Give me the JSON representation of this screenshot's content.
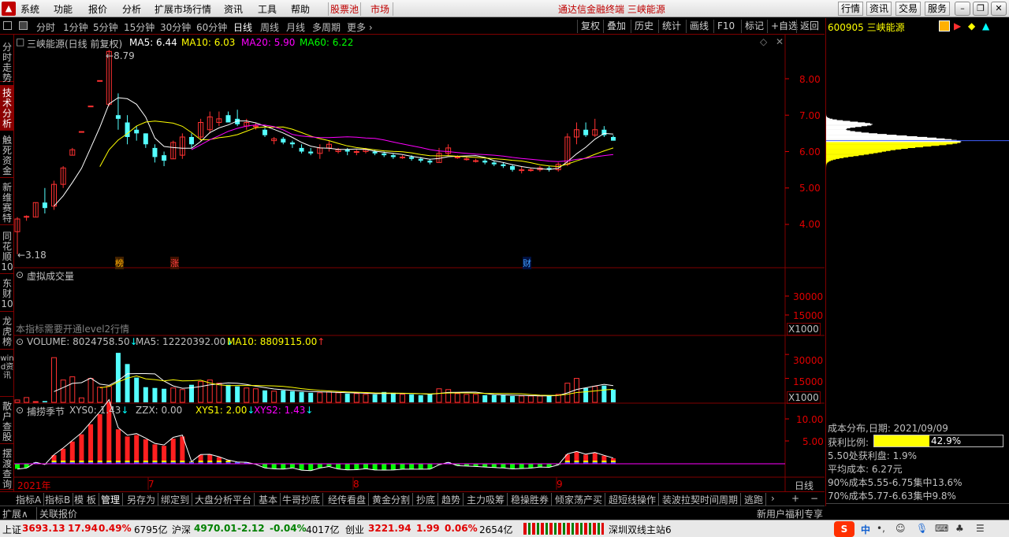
{
  "menu": {
    "items": [
      "系统",
      "功能",
      "报价",
      "分析",
      "扩展市场行情",
      "资讯",
      "工具",
      "帮助"
    ],
    "highlight_items": [
      "股票池",
      "市场"
    ],
    "center_title": "通达信金融终端  三峡能源",
    "right_buttons": [
      "行情",
      "资讯",
      "交易",
      "服务"
    ]
  },
  "toolbar": {
    "periods": [
      "分时",
      "1分钟",
      "5分钟",
      "15分钟",
      "30分钟",
      "60分钟",
      "日线",
      "周线",
      "月线",
      "多周期",
      "更多"
    ],
    "active_period": "日线",
    "right_buttons": [
      "复权",
      "叠加",
      "历史",
      "统计",
      "画线",
      "F10",
      "标记",
      "+自选",
      "返回"
    ]
  },
  "left_tabs": [
    "分时走势",
    "技术分析",
    "触死资金",
    "新维赛特",
    "同花顺10",
    "东财10",
    "龙虎榜",
    "wind资讯",
    "散户查股",
    "摆渡查询"
  ],
  "active_left_tab": "技术分析",
  "main_chart": {
    "title": "三峡能源(日线 前复权)",
    "ma5": "MA5: 6.44",
    "ma10": "MA10: 6.03",
    "ma20": "MA20: 5.90",
    "ma60": "MA60: 6.22",
    "high_label": "8.79",
    "low_label": "3.18",
    "y_ticks": [
      "8.00",
      "7.00",
      "6.00",
      "5.00",
      "4.00"
    ],
    "markers": [
      "榜",
      "涨",
      "财"
    ]
  },
  "virtual_volume": {
    "title": "虚拟成交量",
    "note": "本指标需要开通level2行情",
    "y_ticks": [
      "30000",
      "15000"
    ],
    "unit": "X1000"
  },
  "volume": {
    "title": "VOLUME: 8024758.50",
    "ma5": "MA5: 12220392.00",
    "ma10": "MA10: 8809115.00",
    "y_ticks": [
      "30000",
      "15000"
    ],
    "unit": "X1000"
  },
  "indicator": {
    "title": "捕捞季节",
    "xys0": "XYS0: 1.43",
    "zzx": "ZZX: 0.00",
    "xys1": "XYS1: 2.00",
    "xys2": "XYS2: 1.43",
    "y_ticks": [
      "10.00",
      "5.00"
    ]
  },
  "x_axis": {
    "labels": [
      "2021年",
      "7",
      "8",
      "9"
    ],
    "period": "日线"
  },
  "bottom_tabs": [
    "指标A",
    "指标B",
    "模 板",
    "管理",
    "另存为",
    "绑定到",
    "大盘分析平台",
    "基本",
    "牛哥抄底",
    "经传看盘",
    "黄金分割",
    "抄底",
    "趋势",
    "主力吸筹",
    "稳操胜券",
    "倾家荡产买",
    "超短线操作",
    "装波拉契时间周期",
    "逃跑"
  ],
  "active_bottom_tab": "管理",
  "bottom_bar": {
    "left": "扩展∧",
    "left2": "关联报价",
    "right": "新用户福利专享"
  },
  "right_panel": {
    "code_name": "600905 三峡能源",
    "cost_date": "成本分布,日期: 2021/09/09",
    "profit_ratio_label": "获利比例:",
    "profit_ratio": "42.9%",
    "profit_at": "5.50处获利盘: 1.9%",
    "avg_cost": "平均成本: 6.27元",
    "cost90": "90%成本5.55-6.75集中13.6%",
    "cost70": "70%成本5.77-6.63集中9.8%",
    "tabs": [
      "笔",
      "价",
      "细",
      "势",
      "联",
      "值",
      "主",
      "筹"
    ]
  },
  "status": {
    "sh_label": "上证",
    "sh_val": "3693.13",
    "sh_chg": "17.94",
    "sh_pct": "0.49%",
    "sh_amt": "6795亿",
    "hs_label": "沪深",
    "hs_val": "4970.01",
    "hs_chg": "-2.12",
    "hs_pct": "-0.04%",
    "hs_amt": "4017亿",
    "cy_label": "创业",
    "cy_val": "3221.94",
    "cy_chg": "1.99",
    "cy_pct": "0.06%",
    "cy_amt": "2654亿",
    "server": "深圳双线主站6"
  },
  "chart_data": {
    "type": "candlestick",
    "dates_note": "",
    "ohlc": [
      [
        3.8,
        4.2,
        3.18,
        4.15
      ],
      [
        4.2,
        4.25,
        4.1,
        4.22
      ],
      [
        4.2,
        4.6,
        4.2,
        4.6
      ],
      [
        4.6,
        5.0,
        4.3,
        4.45
      ],
      [
        4.5,
        5.2,
        4.4,
        5.1
      ],
      [
        5.1,
        5.6,
        5.0,
        5.55
      ],
      [
        5.9,
        6.1,
        5.9,
        6.05
      ],
      [
        6.55,
        6.55,
        6.55,
        6.55
      ],
      [
        7.25,
        7.25,
        7.25,
        7.25
      ],
      [
        7.95,
        7.95,
        7.95,
        7.95
      ],
      [
        7.3,
        8.79,
        7.25,
        8.75
      ],
      [
        7.0,
        7.6,
        6.6,
        6.9
      ],
      [
        6.8,
        7.0,
        6.2,
        6.4
      ],
      [
        6.6,
        6.7,
        6.3,
        6.5
      ],
      [
        6.5,
        6.5,
        6.1,
        6.2
      ],
      [
        6.1,
        6.2,
        5.7,
        5.85
      ],
      [
        5.9,
        6.0,
        5.6,
        5.75
      ],
      [
        5.8,
        6.3,
        5.8,
        6.25
      ],
      [
        5.9,
        6.5,
        5.8,
        6.4
      ],
      [
        6.4,
        6.5,
        6.1,
        6.2
      ],
      [
        6.4,
        6.9,
        6.3,
        6.8
      ],
      [
        6.6,
        7.1,
        6.5,
        6.95
      ],
      [
        6.8,
        7.1,
        6.7,
        6.9
      ],
      [
        7.0,
        7.1,
        6.8,
        6.8
      ],
      [
        6.9,
        7.15,
        6.7,
        6.75
      ],
      [
        6.7,
        6.9,
        6.6,
        6.8
      ],
      [
        6.7,
        6.8,
        6.6,
        6.7
      ],
      [
        6.6,
        6.65,
        6.4,
        6.45
      ],
      [
        6.3,
        6.4,
        6.2,
        6.35
      ],
      [
        6.35,
        6.4,
        6.2,
        6.25
      ],
      [
        6.25,
        6.3,
        6.1,
        6.2
      ],
      [
        6.1,
        6.2,
        5.95,
        6.0
      ],
      [
        6.0,
        6.1,
        5.9,
        5.95
      ],
      [
        5.95,
        6.2,
        5.8,
        6.1
      ],
      [
        6.1,
        6.3,
        6.0,
        6.2
      ],
      [
        6.0,
        6.1,
        5.95,
        6.05
      ],
      [
        6.05,
        6.1,
        5.9,
        6.0
      ],
      [
        6.0,
        6.05,
        5.9,
        6.0
      ],
      [
        6.0,
        6.1,
        5.95,
        6.05
      ],
      [
        6.0,
        6.05,
        5.9,
        5.95
      ],
      [
        5.95,
        6.0,
        5.85,
        5.9
      ],
      [
        5.9,
        5.95,
        5.8,
        5.85
      ],
      [
        5.85,
        5.9,
        5.8,
        5.85
      ],
      [
        5.85,
        5.9,
        5.75,
        5.8
      ],
      [
        5.8,
        5.85,
        5.7,
        5.75
      ],
      [
        5.75,
        5.8,
        5.65,
        5.7
      ],
      [
        5.7,
        6.1,
        5.7,
        5.95
      ],
      [
        5.95,
        6.2,
        5.9,
        6.1
      ],
      [
        5.85,
        5.9,
        5.8,
        5.85
      ],
      [
        5.8,
        5.85,
        5.75,
        5.8
      ],
      [
        5.75,
        5.8,
        5.7,
        5.75
      ],
      [
        5.75,
        5.8,
        5.65,
        5.7
      ],
      [
        5.7,
        5.75,
        5.6,
        5.65
      ],
      [
        5.65,
        5.7,
        5.55,
        5.6
      ],
      [
        5.6,
        5.65,
        5.45,
        5.5
      ],
      [
        5.5,
        5.6,
        5.4,
        5.5
      ],
      [
        5.5,
        5.55,
        5.45,
        5.5
      ],
      [
        5.5,
        5.6,
        5.45,
        5.55
      ],
      [
        5.55,
        5.6,
        5.45,
        5.5
      ],
      [
        5.5,
        5.7,
        5.45,
        5.65
      ],
      [
        5.65,
        6.5,
        5.6,
        6.4
      ],
      [
        6.4,
        6.8,
        6.2,
        6.6
      ],
      [
        6.6,
        6.8,
        6.4,
        6.45
      ],
      [
        6.45,
        6.9,
        6.4,
        6.6
      ],
      [
        6.6,
        6.7,
        6.4,
        6.45
      ],
      [
        6.4,
        6.45,
        6.3,
        6.3
      ]
    ],
    "volume": [
      1500,
      3000,
      500,
      800,
      28000,
      14000,
      16000,
      2800,
      15000,
      9500,
      10000,
      31000,
      24000,
      15500,
      9500,
      9000,
      8500,
      9000,
      8000,
      11000,
      13000,
      14000,
      12000,
      11000,
      10000,
      9000,
      8500,
      7500,
      7000,
      7500,
      7000,
      6500,
      6000,
      6000,
      6500,
      6000,
      5500,
      5500,
      5000,
      5000,
      6500,
      6000,
      5000,
      5000,
      4500,
      5000,
      8500,
      8000,
      5500,
      5000,
      5000,
      4500,
      4500,
      4500,
      4000,
      4000,
      4000,
      4000,
      4500,
      5000,
      12000,
      15000,
      9000,
      10000,
      10500,
      8000
    ],
    "y_range": [
      3.0,
      9.0
    ],
    "volume_range": [
      0,
      35000
    ]
  }
}
